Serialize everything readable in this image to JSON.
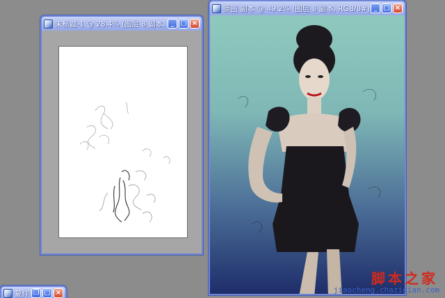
{
  "windows": [
    {
      "title": "未标题-1 @ 28.4% (图层 8 副本, R...",
      "controls": [
        "minimize",
        "maximize",
        "close"
      ]
    },
    {
      "title": "原图 副本 @ 49.2% (图层 8 副本, RGB/8#)",
      "controls": [
        "minimize",
        "maximize",
        "close"
      ]
    },
    {
      "title": "复件 ...",
      "controls": [
        "restore",
        "maximize",
        "close"
      ]
    }
  ],
  "watermark": {
    "main": "脚本之家",
    "sub": "jiaocheng.chazidian.com"
  },
  "colors": {
    "titlebar": "#a8b8ee",
    "window_border": "#6f86d6",
    "workspace": "#8c8c8c",
    "photo_bg_top": "#8fc9bd",
    "photo_bg_bottom": "#1e2d6a",
    "watermark": "#d12a1e"
  },
  "icons": {
    "minimize": "_",
    "maximize": "□",
    "restore": "❐",
    "close": "×"
  }
}
